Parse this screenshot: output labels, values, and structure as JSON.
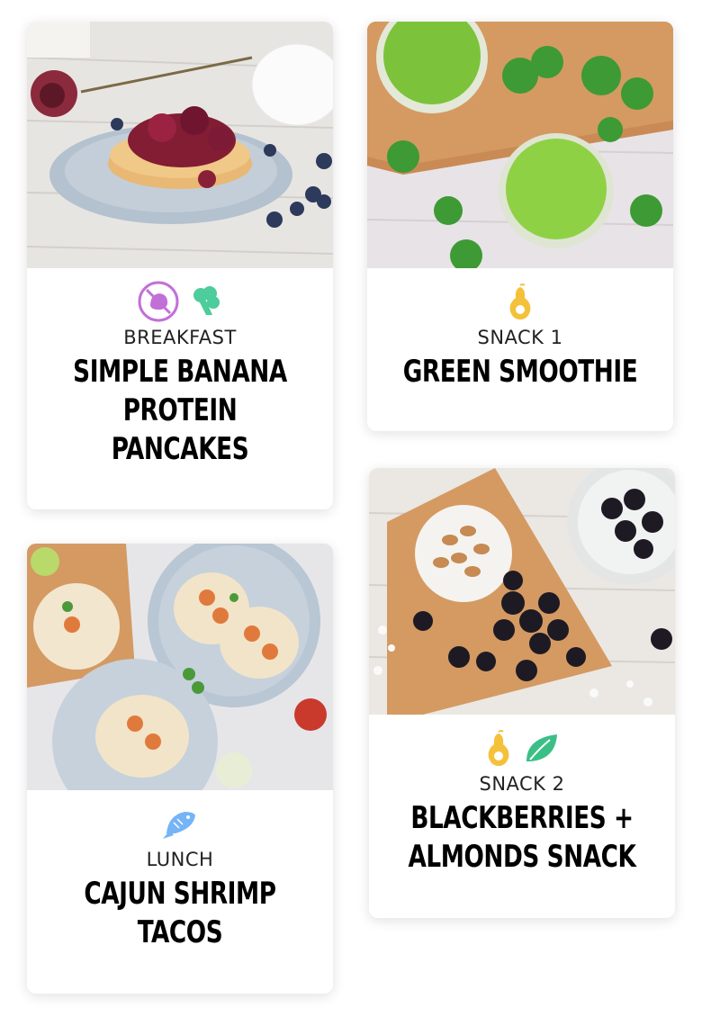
{
  "cards": [
    {
      "meal_type": "BREAKFAST",
      "title": "SIMPLE BANANA PROTEIN PANCAKES",
      "title_lines": [
        "SIMPLE BANANA",
        "PROTEIN",
        "PANCAKES"
      ],
      "photo": "pancakes-with-berries-photo",
      "icons": [
        "no-dairy-icon",
        "broccoli-icon"
      ]
    },
    {
      "meal_type": "SNACK 1",
      "title": "GREEN SMOOTHIE",
      "title_lines": [
        "GREEN SMOOTHIE"
      ],
      "photo": "green-smoothie-photo",
      "icons": [
        "pear-icon"
      ]
    },
    {
      "meal_type": "LUNCH",
      "title": "CAJUN SHRIMP TACOS",
      "title_lines": [
        "CAJUN SHRIMP",
        "TACOS"
      ],
      "photo": "shrimp-tacos-photo",
      "icons": [
        "fish-icon"
      ]
    },
    {
      "meal_type": "SNACK 2",
      "title": "BLACKBERRIES + ALMONDS SNACK",
      "title_lines": [
        "BLACKBERRIES +",
        "ALMONDS SNACK"
      ],
      "photo": "blackberries-almonds-photo",
      "icons": [
        "pear-icon",
        "leaf-icon"
      ]
    }
  ],
  "colors": {
    "no_dairy": "#c36fd8",
    "broccoli": "#4ccd9b",
    "pear": "#f5c13a",
    "fish": "#74b4f7",
    "leaf": "#3bbf86"
  }
}
